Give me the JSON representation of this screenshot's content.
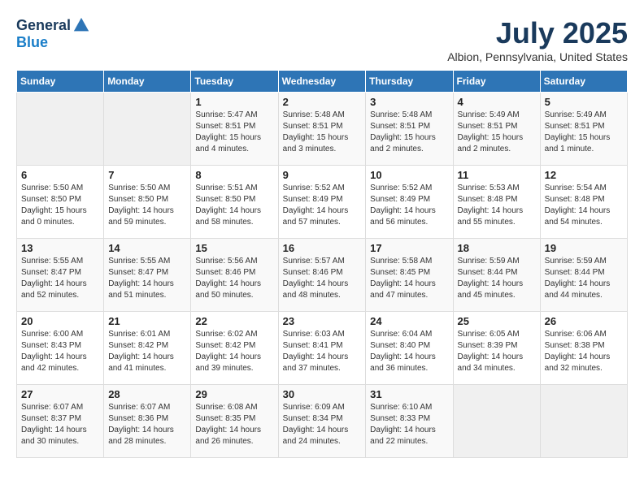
{
  "logo": {
    "general": "General",
    "blue": "Blue"
  },
  "header": {
    "month": "July 2025",
    "location": "Albion, Pennsylvania, United States"
  },
  "weekdays": [
    "Sunday",
    "Monday",
    "Tuesday",
    "Wednesday",
    "Thursday",
    "Friday",
    "Saturday"
  ],
  "weeks": [
    [
      null,
      null,
      {
        "day": 1,
        "sunrise": "Sunrise: 5:47 AM",
        "sunset": "Sunset: 8:51 PM",
        "daylight": "Daylight: 15 hours and 4 minutes."
      },
      {
        "day": 2,
        "sunrise": "Sunrise: 5:48 AM",
        "sunset": "Sunset: 8:51 PM",
        "daylight": "Daylight: 15 hours and 3 minutes."
      },
      {
        "day": 3,
        "sunrise": "Sunrise: 5:48 AM",
        "sunset": "Sunset: 8:51 PM",
        "daylight": "Daylight: 15 hours and 2 minutes."
      },
      {
        "day": 4,
        "sunrise": "Sunrise: 5:49 AM",
        "sunset": "Sunset: 8:51 PM",
        "daylight": "Daylight: 15 hours and 2 minutes."
      },
      {
        "day": 5,
        "sunrise": "Sunrise: 5:49 AM",
        "sunset": "Sunset: 8:51 PM",
        "daylight": "Daylight: 15 hours and 1 minute."
      }
    ],
    [
      {
        "day": 6,
        "sunrise": "Sunrise: 5:50 AM",
        "sunset": "Sunset: 8:50 PM",
        "daylight": "Daylight: 15 hours and 0 minutes."
      },
      {
        "day": 7,
        "sunrise": "Sunrise: 5:50 AM",
        "sunset": "Sunset: 8:50 PM",
        "daylight": "Daylight: 14 hours and 59 minutes."
      },
      {
        "day": 8,
        "sunrise": "Sunrise: 5:51 AM",
        "sunset": "Sunset: 8:50 PM",
        "daylight": "Daylight: 14 hours and 58 minutes."
      },
      {
        "day": 9,
        "sunrise": "Sunrise: 5:52 AM",
        "sunset": "Sunset: 8:49 PM",
        "daylight": "Daylight: 14 hours and 57 minutes."
      },
      {
        "day": 10,
        "sunrise": "Sunrise: 5:52 AM",
        "sunset": "Sunset: 8:49 PM",
        "daylight": "Daylight: 14 hours and 56 minutes."
      },
      {
        "day": 11,
        "sunrise": "Sunrise: 5:53 AM",
        "sunset": "Sunset: 8:48 PM",
        "daylight": "Daylight: 14 hours and 55 minutes."
      },
      {
        "day": 12,
        "sunrise": "Sunrise: 5:54 AM",
        "sunset": "Sunset: 8:48 PM",
        "daylight": "Daylight: 14 hours and 54 minutes."
      }
    ],
    [
      {
        "day": 13,
        "sunrise": "Sunrise: 5:55 AM",
        "sunset": "Sunset: 8:47 PM",
        "daylight": "Daylight: 14 hours and 52 minutes."
      },
      {
        "day": 14,
        "sunrise": "Sunrise: 5:55 AM",
        "sunset": "Sunset: 8:47 PM",
        "daylight": "Daylight: 14 hours and 51 minutes."
      },
      {
        "day": 15,
        "sunrise": "Sunrise: 5:56 AM",
        "sunset": "Sunset: 8:46 PM",
        "daylight": "Daylight: 14 hours and 50 minutes."
      },
      {
        "day": 16,
        "sunrise": "Sunrise: 5:57 AM",
        "sunset": "Sunset: 8:46 PM",
        "daylight": "Daylight: 14 hours and 48 minutes."
      },
      {
        "day": 17,
        "sunrise": "Sunrise: 5:58 AM",
        "sunset": "Sunset: 8:45 PM",
        "daylight": "Daylight: 14 hours and 47 minutes."
      },
      {
        "day": 18,
        "sunrise": "Sunrise: 5:59 AM",
        "sunset": "Sunset: 8:44 PM",
        "daylight": "Daylight: 14 hours and 45 minutes."
      },
      {
        "day": 19,
        "sunrise": "Sunrise: 5:59 AM",
        "sunset": "Sunset: 8:44 PM",
        "daylight": "Daylight: 14 hours and 44 minutes."
      }
    ],
    [
      {
        "day": 20,
        "sunrise": "Sunrise: 6:00 AM",
        "sunset": "Sunset: 8:43 PM",
        "daylight": "Daylight: 14 hours and 42 minutes."
      },
      {
        "day": 21,
        "sunrise": "Sunrise: 6:01 AM",
        "sunset": "Sunset: 8:42 PM",
        "daylight": "Daylight: 14 hours and 41 minutes."
      },
      {
        "day": 22,
        "sunrise": "Sunrise: 6:02 AM",
        "sunset": "Sunset: 8:42 PM",
        "daylight": "Daylight: 14 hours and 39 minutes."
      },
      {
        "day": 23,
        "sunrise": "Sunrise: 6:03 AM",
        "sunset": "Sunset: 8:41 PM",
        "daylight": "Daylight: 14 hours and 37 minutes."
      },
      {
        "day": 24,
        "sunrise": "Sunrise: 6:04 AM",
        "sunset": "Sunset: 8:40 PM",
        "daylight": "Daylight: 14 hours and 36 minutes."
      },
      {
        "day": 25,
        "sunrise": "Sunrise: 6:05 AM",
        "sunset": "Sunset: 8:39 PM",
        "daylight": "Daylight: 14 hours and 34 minutes."
      },
      {
        "day": 26,
        "sunrise": "Sunrise: 6:06 AM",
        "sunset": "Sunset: 8:38 PM",
        "daylight": "Daylight: 14 hours and 32 minutes."
      }
    ],
    [
      {
        "day": 27,
        "sunrise": "Sunrise: 6:07 AM",
        "sunset": "Sunset: 8:37 PM",
        "daylight": "Daylight: 14 hours and 30 minutes."
      },
      {
        "day": 28,
        "sunrise": "Sunrise: 6:07 AM",
        "sunset": "Sunset: 8:36 PM",
        "daylight": "Daylight: 14 hours and 28 minutes."
      },
      {
        "day": 29,
        "sunrise": "Sunrise: 6:08 AM",
        "sunset": "Sunset: 8:35 PM",
        "daylight": "Daylight: 14 hours and 26 minutes."
      },
      {
        "day": 30,
        "sunrise": "Sunrise: 6:09 AM",
        "sunset": "Sunset: 8:34 PM",
        "daylight": "Daylight: 14 hours and 24 minutes."
      },
      {
        "day": 31,
        "sunrise": "Sunrise: 6:10 AM",
        "sunset": "Sunset: 8:33 PM",
        "daylight": "Daylight: 14 hours and 22 minutes."
      },
      null,
      null
    ]
  ]
}
